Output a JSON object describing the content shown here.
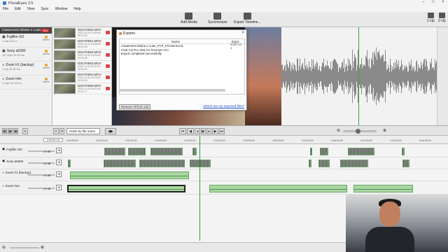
{
  "app": {
    "title": "PluralEyes 3.5"
  },
  "menu": [
    "File",
    "Edit",
    "View",
    "Sync",
    "Window",
    "Help"
  ],
  "toolbar": {
    "add_media": "Add Media",
    "synchronize": "Synchronize",
    "export_timeline": "Export Timeline...",
    "layout_1": "1-Up",
    "layout_2": "2-Up"
  },
  "sources": {
    "title": "Casamento Elaine e Luan",
    "count": "900",
    "items": [
      {
        "name": "Fujifilm Xt2",
        "meta": "1 clip   24.8 m",
        "side": "stereo"
      },
      {
        "name": "Sony a6300",
        "meta": "157 clips   04:34 hrs",
        "side": "stereo"
      },
      {
        "name": "Zoom h1 (backup)",
        "meta": "1 clip   46.33 hrs",
        "side": "stereo"
      },
      {
        "name": "Zoom h4n",
        "meta": "2 clips   46.33 hrs",
        "side": "stereo"
      }
    ]
  },
  "clips": [
    {
      "name": "DSCF0060.MOV",
      "d1": "2022-12-04 15:56:45",
      "d2": "00:12:00"
    },
    {
      "name": "DSCF0061.MOV",
      "d1": "2022-12-04 15:56:55",
      "d2": "00:01:18"
    },
    {
      "name": "DSCF0062.MOV",
      "d1": "2022-12-04 16:00:28",
      "d2": "00:00:48"
    },
    {
      "name": "DSCF0063.MOV",
      "d1": "2022-12-04 16:07:02",
      "d2": "00:01:02"
    },
    {
      "name": "DSCF0064.MOV",
      "d1": "2022-12-04 16:29:40",
      "d2": "00:00:26"
    },
    {
      "name": "DSCF0065.MOV",
      "d1": "2022-12-04 16:33:36",
      "d2": "00:01:17"
    }
  ],
  "dialog": {
    "title": "Exports",
    "col_name": "Name",
    "col_expo": "Expo",
    "rows": [
      {
        "name": "Casamento Elaine e Luan_FCP_PremiereUnd",
        "expo": "2022-12-1"
      },
      {
        "name": "Final Cut Pro XML for Premiere Pro",
        "expo": ""
      },
      {
        "name": "Export completed successfully",
        "expo": ""
      }
    ],
    "remove_all": "Remove All from List",
    "where": "Where are my exported files?"
  },
  "timeline": {
    "order": "Order by file name",
    "timecode": "3:00:11:12",
    "ticks": [
      "0:00:00:00",
      "0:25:00:00",
      "0:50:00:00",
      "1:15:00:00",
      "1:40:00:00",
      "2:05:00:00",
      "2:30:00:00",
      "2:55:00:00",
      "3:20:00:00",
      "3:45:00:00",
      "4:10:00:00",
      "4:35:00:00",
      "5:00:00:00"
    ],
    "tracks": [
      {
        "name": "Fujifilm Xt2",
        "vol": "0.0 dB"
      },
      {
        "name": "Sony a6300",
        "vol": "0.0 dB"
      },
      {
        "name": "Zoom h1 (backup)",
        "vol": "0.0 dB"
      },
      {
        "name": "Zoom h4n",
        "vol": "0.0 dB"
      }
    ]
  }
}
